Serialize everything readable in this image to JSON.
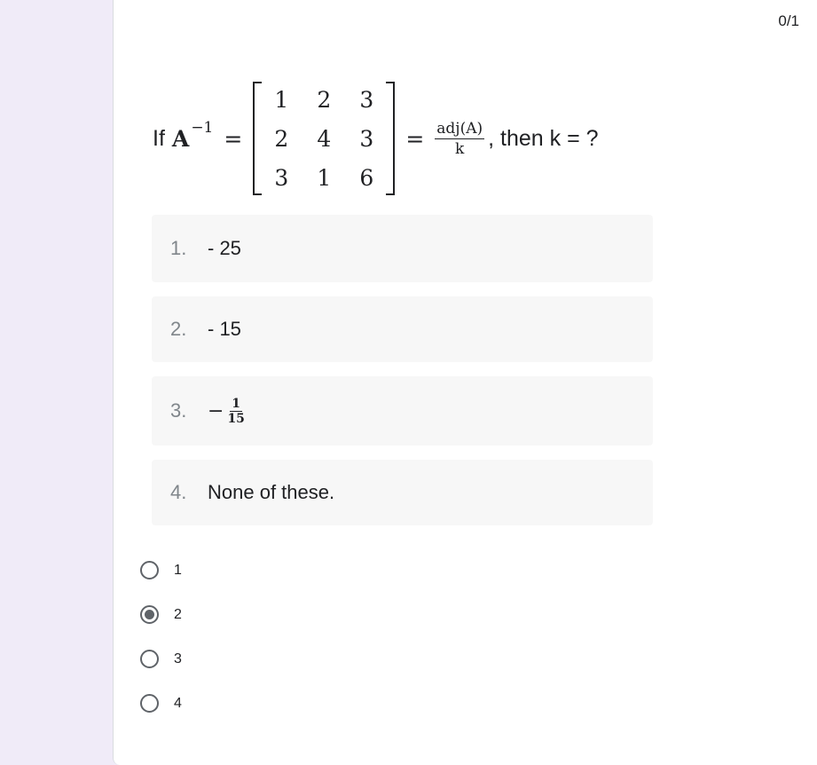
{
  "score": "0/1",
  "question": {
    "prefix": "If",
    "lhs_base": "A",
    "lhs_exponent": "−1",
    "equals": "=",
    "matrix": [
      [
        "1",
        "2",
        "3"
      ],
      [
        "2",
        "4",
        "3"
      ],
      [
        "3",
        "1",
        "6"
      ]
    ],
    "frac_numerator": "adj(A)",
    "frac_denominator": "k",
    "suffix": ", then k = ?"
  },
  "options": [
    {
      "number": "1.",
      "text": "- 25"
    },
    {
      "number": "2.",
      "text": "- 15"
    },
    {
      "number": "3.",
      "minus": "−",
      "numerator": "1",
      "denominator": "15"
    },
    {
      "number": "4.",
      "text": "None of these."
    }
  ],
  "choices": [
    {
      "label": "1",
      "checked": false
    },
    {
      "label": "2",
      "checked": true
    },
    {
      "label": "3",
      "checked": false
    },
    {
      "label": "4",
      "checked": false
    }
  ],
  "colors": {
    "page_background": "#f0ebf8",
    "card_background": "#ffffff",
    "option_background": "#f7f7f7",
    "radio_color": "#5f6368"
  }
}
